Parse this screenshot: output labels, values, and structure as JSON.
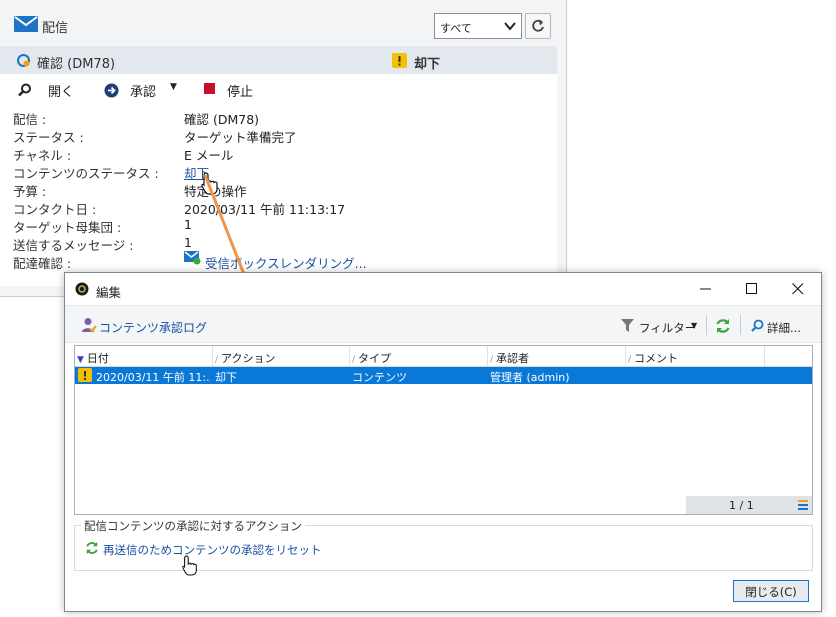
{
  "delivery_panel": {
    "title": "配信",
    "filter": {
      "selected": "すべて"
    },
    "subheader": {
      "title": "確認 (DM78)",
      "status": "却下"
    },
    "toolbar": {
      "open": "開く",
      "approve": "承認",
      "stop": "停止"
    },
    "properties": [
      {
        "label": "配信 :",
        "value": "確認 (DM78)"
      },
      {
        "label": "ステータス :",
        "value": "ターゲット準備完了"
      },
      {
        "label": "チャネル :",
        "value": "E メール"
      },
      {
        "label": "コンテンツのステータス :",
        "value": "却下"
      },
      {
        "label": "予算 :",
        "value": "特定の操作"
      },
      {
        "label": "コンタクト日 :",
        "value": "2020/03/11 午前 11:13:17"
      },
      {
        "label": "ターゲット母集団 :",
        "value": "1"
      },
      {
        "label": "送信するメッセージ :",
        "value": "1"
      },
      {
        "label": "配達確認 :",
        "value": "受信ボックスレンダリング..."
      }
    ]
  },
  "dialog": {
    "title": "編集",
    "toolbar": {
      "log_tab": "コンテンツ承認ログ",
      "filter": "フィルター",
      "detail": "詳細..."
    },
    "grid": {
      "columns": [
        "日付",
        "アクション",
        "タイプ",
        "承認者",
        "コメント"
      ],
      "rows": [
        {
          "date": "2020/03/11 午前 11:...",
          "action": "却下",
          "type": "コンテンツ",
          "approver": "管理者 (admin)",
          "comment": ""
        }
      ],
      "pager": "1 / 1"
    },
    "action_group": {
      "legend": "配信コンテンツの承認に対するアクション",
      "reset_link": "再送信のためコンテンツの承認をリセット"
    },
    "close_button": "閉じる(C)"
  },
  "colors": {
    "accent": "#0a78d7",
    "link": "#1a4fa3",
    "arrow": "#f0954a",
    "warning": "#f2c200",
    "stop": "#c8102e"
  }
}
